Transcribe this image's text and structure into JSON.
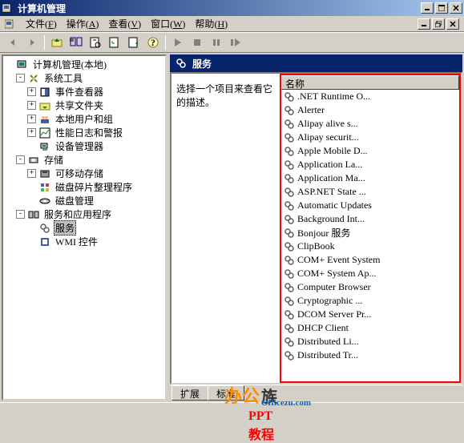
{
  "window": {
    "title": "计算机管理"
  },
  "menu": {
    "file": "文件",
    "file_u": "F",
    "action": "操作",
    "action_u": "A",
    "view": "查看",
    "view_u": "V",
    "window": "窗口",
    "window_u": "W",
    "help": "帮助",
    "help_u": "H"
  },
  "tree": {
    "root": "计算机管理(本地)",
    "systools": "系统工具",
    "eventviewer": "事件查看器",
    "shared": "共享文件夹",
    "localusers": "本地用户和组",
    "perflog": "性能日志和警报",
    "devmgr": "设备管理器",
    "storage": "存储",
    "removable": "可移动存储",
    "defrag": "磁盘碎片整理程序",
    "diskmgmt": "磁盘管理",
    "svcapp": "服务和应用程序",
    "services": "服务",
    "wmi": "WMI 控件"
  },
  "detail": {
    "heading": "服务",
    "desc": "选择一个项目来查看它的描述。",
    "namecol": "名称"
  },
  "services": [
    ".NET Runtime O...",
    "Alerter",
    "Alipay alive s...",
    "Alipay securit...",
    "Apple Mobile D...",
    "Application La...",
    "Application Ma...",
    "ASP.NET State ...",
    "Automatic Updates",
    "Background Int...",
    "Bonjour 服务",
    "ClipBook",
    "COM+ Event System",
    "COM+ System Ap...",
    "Computer Browser",
    "Cryptographic ...",
    "DCOM Server Pr...",
    "DHCP Client",
    "Distributed Li...",
    "Distributed Tr..."
  ],
  "tabs": {
    "ext": "扩展",
    "std": "标准"
  },
  "watermark": {
    "brand1": "办公",
    "brand2": "族",
    "url": "Officezu.com",
    "line2": "PPT教程"
  }
}
